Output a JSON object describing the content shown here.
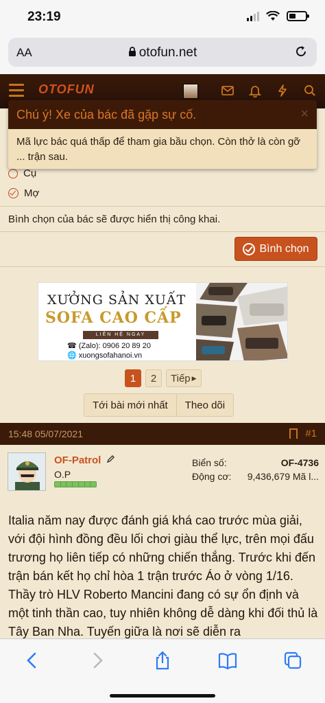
{
  "status_bar": {
    "time": "23:19"
  },
  "browser": {
    "text_size_label": "AA",
    "url": "otofun.net"
  },
  "site": {
    "logo": "OTOFUN"
  },
  "toast": {
    "title": "Chú ý! Xe của bác đã gặp sự cố.",
    "close": "×",
    "message": "Mã lực bác quá thấp để tham gia bầu chọn. Còn thở là còn gỡ ... trận sau."
  },
  "poll": {
    "options": [
      {
        "label": "Cụ",
        "selected": false
      },
      {
        "label": "Mợ",
        "selected": true
      }
    ],
    "public_note": "Bình chọn của bác sẽ được hiển thị công khai.",
    "vote_button": "Bình chọn"
  },
  "ad": {
    "line1": "XƯỞNG SẢN XUẤT",
    "line2": "SOFA CAO CẤP",
    "ribbon": "LIÊN HỆ NGAY",
    "phone": "(Zalo): 0906 20 89 20",
    "site": "xuongsofahanoi.vn"
  },
  "pagination": {
    "pages": [
      "1",
      "2"
    ],
    "current": "1",
    "next": "Tiếp"
  },
  "thread_actions": {
    "latest": "Tới bài mới nhất",
    "watch": "Theo dõi"
  },
  "post": {
    "date": "15:48 05/07/2021",
    "number": "#1",
    "user": {
      "name": "OF-Patrol",
      "title": "O.P",
      "plate_label": "Biển số:",
      "plate_value": "OF-4736",
      "engine_label": "Động cơ:",
      "engine_value": "9,436,679 Mã l..."
    },
    "body": "Italia năm nay được đánh giá khá cao trước mùa giải, với đội hình đồng đều lối chơi giàu thể lực, trên mọi đấu trương họ liên tiếp có những chiến thắng. Trước khi đến trận bán kết họ chỉ hòa 1 trận trước Áo ở vòng 1/16. Thầy trò HLV Roberto Mancini đang có sự ổn định và một tinh thần cao, tuy nhiên không dễ dàng khi đối thủ là Tây Ban Nha. Tuyến giữa là nơi sẽ diễn ra"
  },
  "colors": {
    "accent": "#c8521e",
    "header_dark": "#3a1a08",
    "page_bg": "#f2e8d2",
    "toast_title": "#d9772a"
  }
}
